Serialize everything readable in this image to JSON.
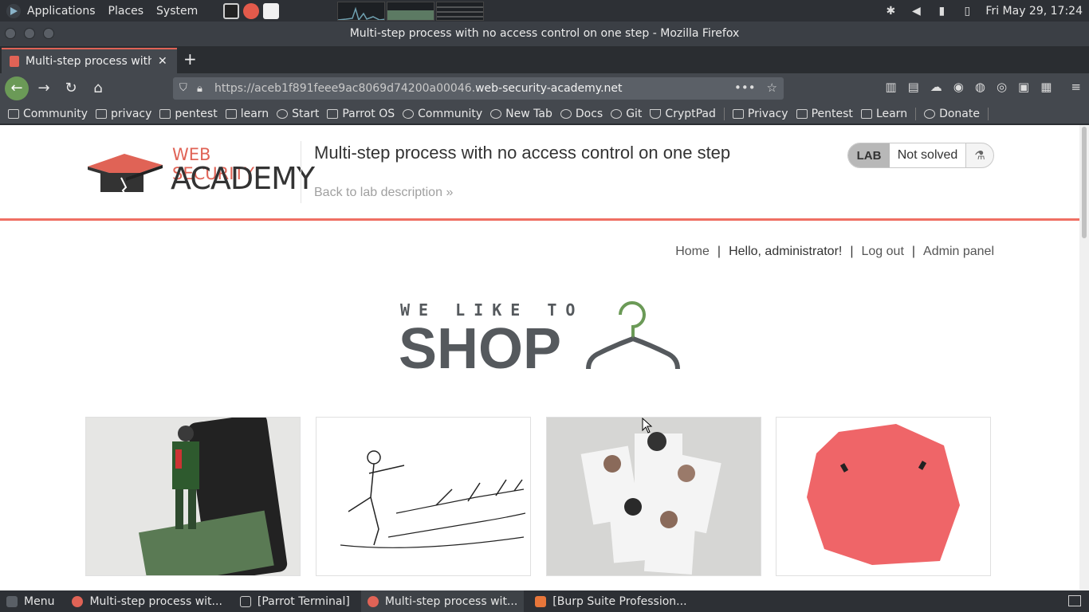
{
  "os_panel": {
    "menus": [
      "Applications",
      "Places",
      "System"
    ],
    "clock": "Fri May 29, 17:24"
  },
  "window": {
    "title": "Multi-step process with no access control on one step - Mozilla Firefox"
  },
  "tabs": [
    {
      "label": "Multi-step process with no access control on one step"
    }
  ],
  "urlbar": {
    "url_prefix": "https://aceb1f891feee9ac8069d74200a00046.",
    "url_host": "web-security-academy.net"
  },
  "bookmarks": [
    {
      "label": "Community",
      "icon": "parrot-icon"
    },
    {
      "label": "privacy",
      "icon": "folder-icon"
    },
    {
      "label": "pentest",
      "icon": "folder-icon"
    },
    {
      "label": "learn",
      "icon": "folder-icon"
    },
    {
      "label": "Start",
      "icon": "globe-icon"
    },
    {
      "label": "Parrot OS",
      "icon": "parrot-icon"
    },
    {
      "label": "Community",
      "icon": "globe-icon"
    },
    {
      "label": "New Tab",
      "icon": "globe-icon"
    },
    {
      "label": "Docs",
      "icon": "globe-icon"
    },
    {
      "label": "Git",
      "icon": "globe-icon"
    },
    {
      "label": "CryptPad",
      "icon": "shield-icon"
    },
    {
      "label": "Privacy",
      "icon": "folder-icon"
    },
    {
      "label": "Pentest",
      "icon": "folder-icon"
    },
    {
      "label": "Learn",
      "icon": "folder-icon"
    },
    {
      "label": "Donate",
      "icon": "globe-icon"
    }
  ],
  "lab": {
    "logo_line1": "WEB SECURITY",
    "logo_line2": "ACADEMY",
    "title": "Multi-step process with no access control on one step",
    "back_link": "Back to lab description",
    "badge": "LAB",
    "status": "Not solved",
    "accent": "#e06356"
  },
  "shop_nav": {
    "home": "Home",
    "greeting": "Hello, administrator!",
    "logout": "Log out",
    "admin": "Admin panel",
    "separator": "|"
  },
  "shop_logo": {
    "small": "WE LIKE TO",
    "big": "SHOP"
  },
  "taskbar": {
    "menu": "Menu",
    "tasks": [
      "Multi-step process wit...",
      "[Parrot Terminal]",
      "Multi-step process wit...",
      "[Burp Suite Profession..."
    ]
  }
}
